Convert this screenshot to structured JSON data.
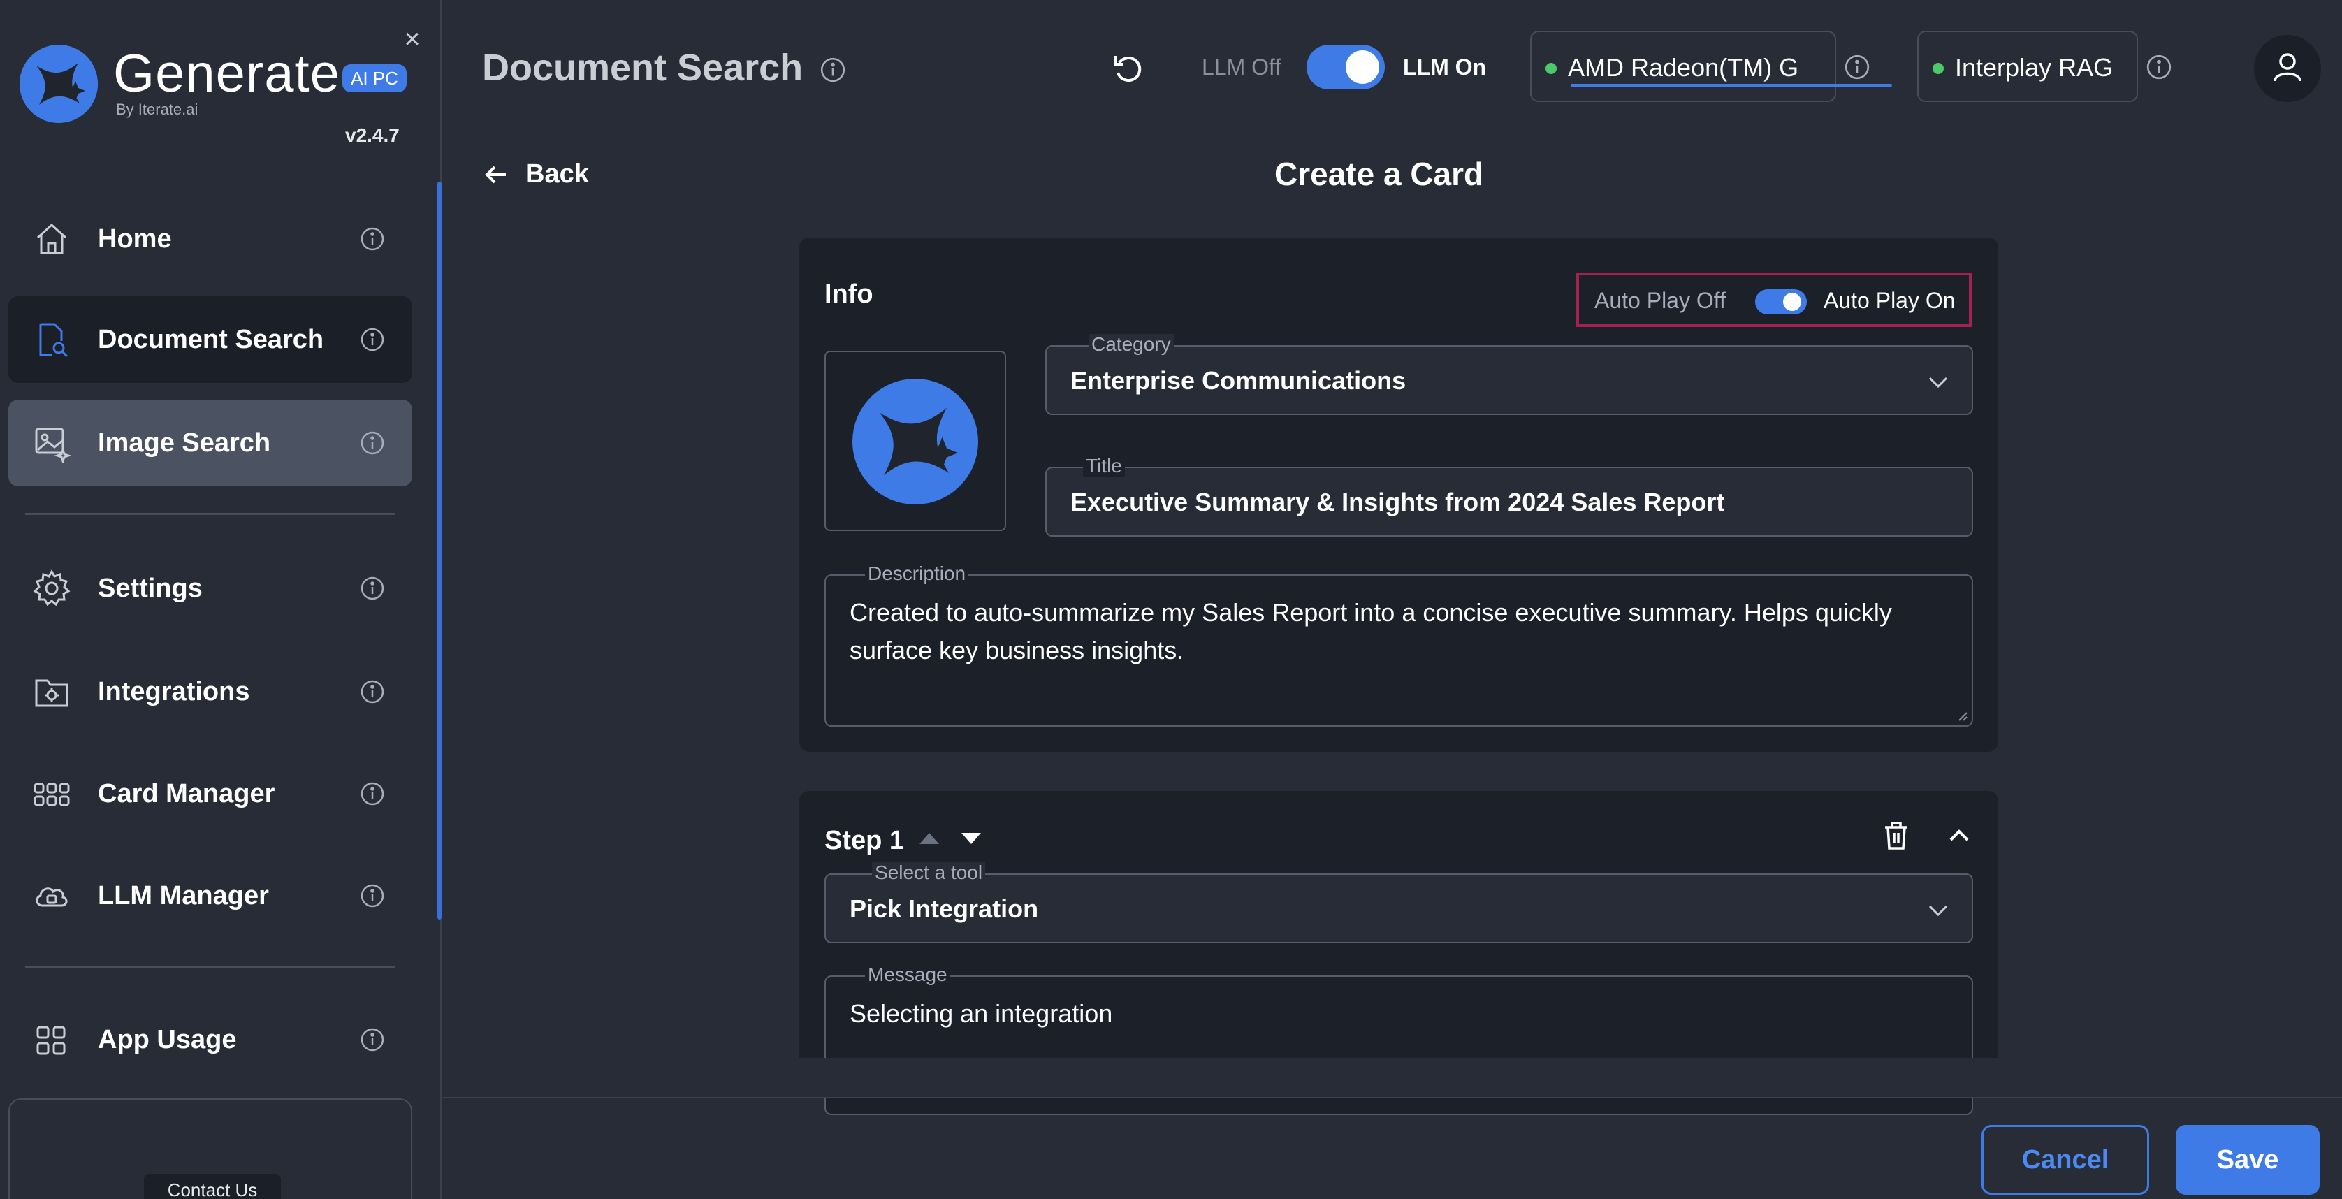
{
  "app": {
    "name": "Generate",
    "badge": "AI PC",
    "by": "By Iterate.ai",
    "version": "v2.4.7",
    "close_symbol": "×"
  },
  "sidebar": {
    "items": [
      {
        "label": "Home",
        "icon": "home-icon"
      },
      {
        "label": "Document Search",
        "icon": "document-search-icon",
        "state": "active"
      },
      {
        "label": "Image Search",
        "icon": "image-search-icon",
        "state": "hover"
      },
      {
        "label": "Settings",
        "icon": "gear-icon"
      },
      {
        "label": "Integrations",
        "icon": "integrations-icon"
      },
      {
        "label": "Card Manager",
        "icon": "grid-icon"
      },
      {
        "label": "LLM Manager",
        "icon": "cloud-chip-icon"
      },
      {
        "label": "App Usage",
        "icon": "apps-icon"
      }
    ],
    "contact_label": "Contact Us"
  },
  "header": {
    "title": "Document Search",
    "llm_off_label": "LLM Off",
    "llm_on_label": "LLM On",
    "llm_enabled": true,
    "device_chip": "AMD Radeon(TM) G",
    "rag_chip": "Interplay RAG"
  },
  "subheader": {
    "back_label": "Back",
    "page_heading": "Create a Card"
  },
  "info_card": {
    "heading": "Info",
    "autoplay_off_label": "Auto Play Off",
    "autoplay_on_label": "Auto Play On",
    "autoplay_enabled": true,
    "category_legend": "Category",
    "category_value": "Enterprise Communications",
    "title_legend": "Title",
    "title_value": "Executive Summary & Insights from 2024 Sales Report",
    "description_legend": "Description",
    "description_value": "Created to auto-summarize my Sales Report into a concise executive summary. Helps quickly surface key business insights."
  },
  "step_card": {
    "heading": "Step 1",
    "tool_legend": "Select a tool",
    "tool_value": "Pick Integration",
    "message_legend": "Message",
    "message_value": "Selecting an integration"
  },
  "footer": {
    "cancel_label": "Cancel",
    "save_label": "Save"
  },
  "colors": {
    "accent": "#3f7be6",
    "highlight_border": "#a3224f",
    "status_green": "#4cc96a"
  }
}
